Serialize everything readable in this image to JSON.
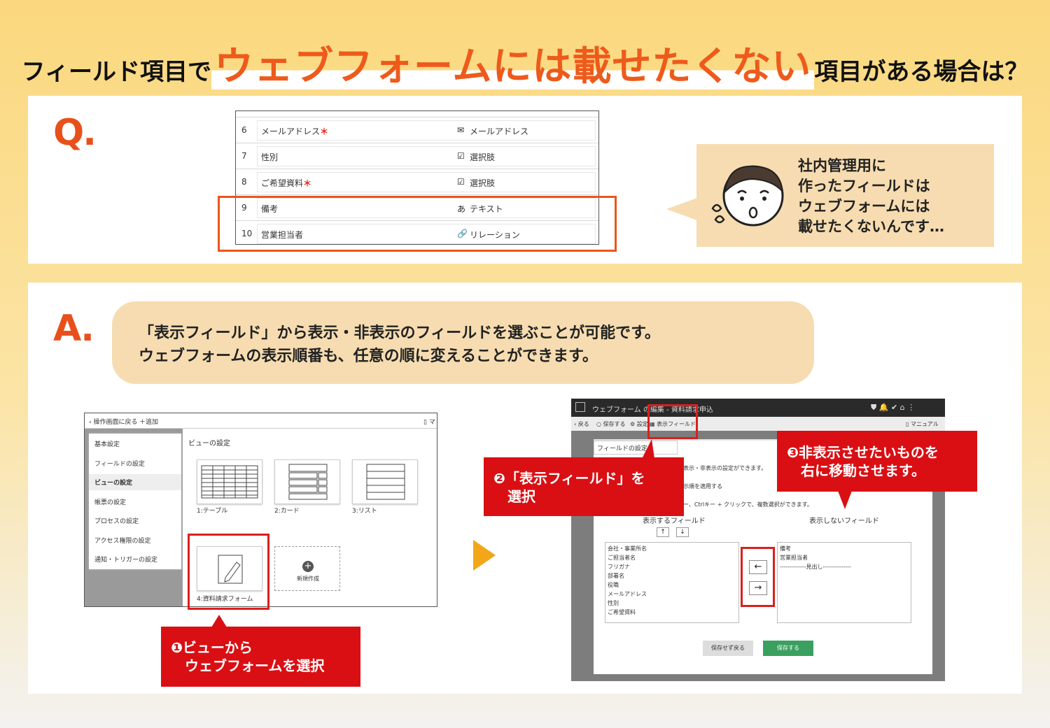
{
  "title": {
    "prefix": "フィールド項目で",
    "highlight": "ウェブフォームには載せたくない",
    "suffix": "項目がある場合は？"
  },
  "question": {
    "letter": "Q.",
    "table_rows": [
      {
        "num": "6",
        "label": "メールアドレス",
        "required": "＊",
        "icon": "✉",
        "type": "メールアドレス"
      },
      {
        "num": "7",
        "label": "性別",
        "required": "",
        "icon": "☑",
        "type": "選択肢"
      },
      {
        "num": "8",
        "label": "ご希望資料",
        "required": "＊",
        "icon": "☑",
        "type": "選択肢"
      },
      {
        "num": "9",
        "label": "備考",
        "required": "",
        "icon": "あ",
        "type": "テキスト"
      },
      {
        "num": "10",
        "label": "営業担当者",
        "required": "",
        "icon": "🔗",
        "type": "リレーション"
      }
    ],
    "bubble_text": "社内管理用に\n作ったフィールドは\nウェブフォームには\n載せたくないんです…"
  },
  "answer": {
    "letter": "A.",
    "line1": "「表示フィールド」から表示・非表示のフィールドを選ぶことが可能です。",
    "line2": "ウェブフォームの表示順番も、任意の順に変えることができます。"
  },
  "shot1": {
    "back": "操作画面に戻る",
    "add": "追加",
    "top_right": "マ",
    "side_items": [
      "基本設定",
      "フィールドの設定",
      "ビューの設定",
      "帳票の設定",
      "プロセスの設定",
      "アクセス権限の設定",
      "通知・トリガーの設定"
    ],
    "active_index": 2,
    "section_title": "ビューの設定",
    "views": [
      "1:テーブル",
      "2:カード",
      "3:リスト",
      "4:資料請求フォーム"
    ],
    "new_label": "新規作成"
  },
  "shot2": {
    "header_title": "ウェブフォーム の編集 - 資料請求申込",
    "toolbar": [
      "戻る",
      "保存する",
      "設定",
      "表示フィールド"
    ],
    "manual": "マニュアル",
    "dialog_title": "フィールドの設定",
    "desc1": "表示・非表示の設定ができます。",
    "desc2": "示順を適用する",
    "desc3": "ー、Ctrlキー + クリックで、複数選択ができます。",
    "shown_label": "表示するフィールド",
    "hidden_label": "表示しないフィールド",
    "shown_fields": [
      "会社・事業所名",
      "ご担当者名",
      "フリガナ",
      "部署名",
      "役職",
      "メールアドレス",
      "性別",
      "ご希望資料"
    ],
    "hidden_fields": [
      "備考",
      "営業担当者",
      "-------------見出し--------------"
    ],
    "cancel_btn": "保存せず戻る",
    "save_btn": "保存する"
  },
  "callouts": {
    "c1": "❶ビューから\n　ウェブフォームを選択",
    "c2": "❷「表示フィールド」を\n　選択",
    "c3": "❸非表示させたいものを\n　右に移動させます。"
  },
  "colors": {
    "accent": "#ee5a1b",
    "callout": "#d90f14",
    "bubble": "#f6dcb0",
    "save_green": "#3aa060"
  }
}
